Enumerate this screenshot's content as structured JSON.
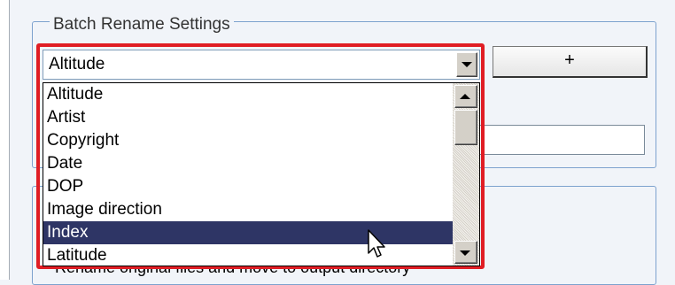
{
  "group": {
    "title": "Batch Rename Settings"
  },
  "buttons": {
    "add_label": "+"
  },
  "combo": {
    "selected": "Altitude",
    "options": [
      "Altitude",
      "Artist",
      "Copyright",
      "Date",
      "DOP",
      "Image direction",
      "Index",
      "Latitude"
    ],
    "highlighted_option": "Index"
  },
  "background_text": "Rename original files and move to output directory",
  "colors": {
    "highlight_frame": "#e01d24",
    "selection": "#2e3565",
    "group_border": "#7da2ce"
  },
  "icons": {
    "cursor": "arrow-pointer-icon"
  }
}
